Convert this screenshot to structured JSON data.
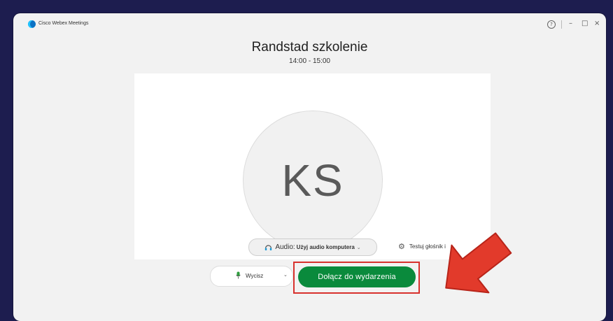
{
  "app": {
    "title": "Cisco Webex Meetings",
    "help_icon": "?",
    "minimize_icon": "–",
    "maximize_icon": "□",
    "close_icon": "×"
  },
  "meeting": {
    "title": "Randstad szkolenie",
    "time": "14:00 - 15:00"
  },
  "avatar": {
    "initials": "KS"
  },
  "audio": {
    "label": "Audio:",
    "value": "Użyj audio komputera"
  },
  "test_speaker": {
    "label": "Testuj głośnik i"
  },
  "mute": {
    "label": "Wycisz"
  },
  "join": {
    "label": "Dołącz do wydarzenia"
  },
  "colors": {
    "background": "#1d1d4f",
    "join_button": "#0a8a3c",
    "highlight_border": "#d8312d",
    "arrow": "#e23a2b"
  }
}
